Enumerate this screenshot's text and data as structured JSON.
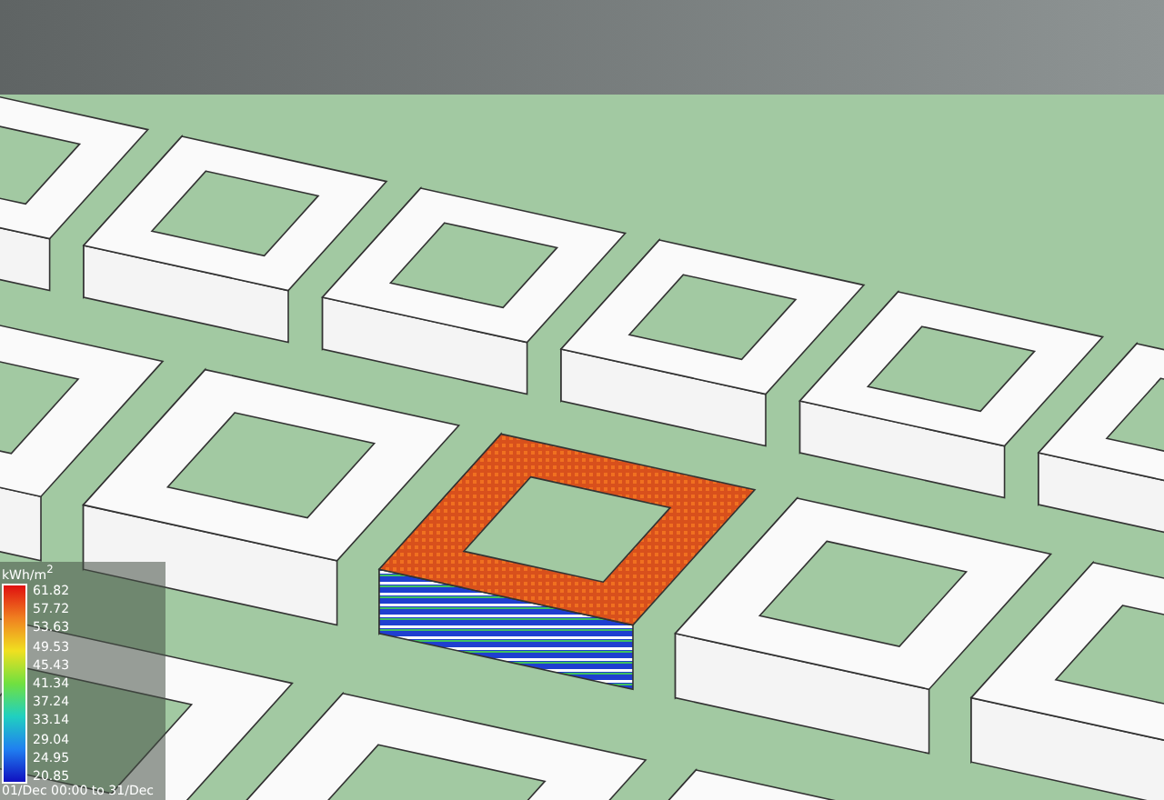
{
  "legend": {
    "unit": "kWh/m$^{2}$",
    "ticks": [
      "61.82",
      "57.72",
      "53.63",
      "49.53",
      "45.43",
      "41.34",
      "37.24",
      "33.14",
      "29.04",
      "24.95",
      "20.85"
    ],
    "period": "01/Dec 00:00 to 31/Dec"
  }
}
